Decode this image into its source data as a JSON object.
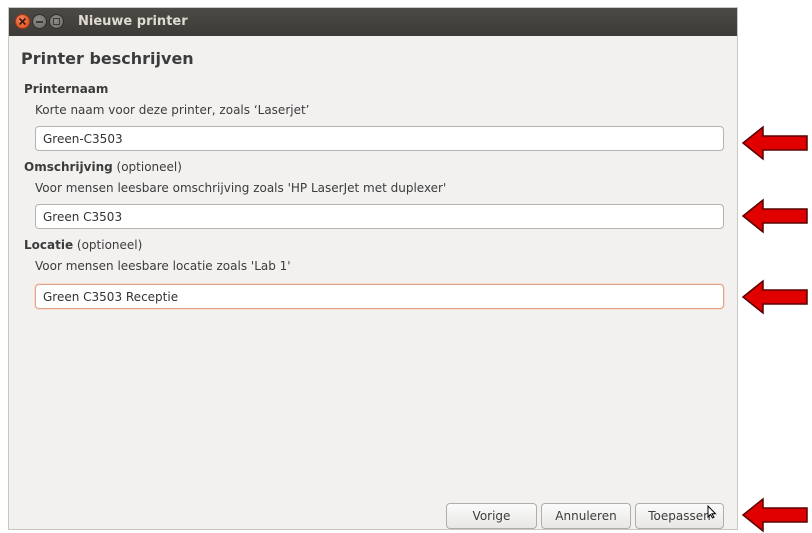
{
  "window": {
    "title": "Nieuwe printer"
  },
  "page": {
    "title": "Printer beschrijven"
  },
  "fields": {
    "printer_name": {
      "label": "Printernaam",
      "hint": "Korte naam voor deze printer, zoals ‘Laserjet’",
      "value": "Green-C3503"
    },
    "description": {
      "label": "Omschrijving",
      "optional": " (optioneel)",
      "hint": "Voor mensen leesbare omschrijving zoals 'HP LaserJet met duplexer'",
      "value": "Green C3503"
    },
    "location": {
      "label": "Locatie",
      "optional": " (optioneel)",
      "hint": "Voor mensen leesbare locatie zoals 'Lab 1'",
      "value": "Green C3503 Receptie"
    }
  },
  "buttons": {
    "back": "Vorige",
    "cancel": "Annuleren",
    "apply": "Toepassen"
  },
  "colors": {
    "annotation_arrow": "#e00000",
    "titlebar": "#3c3b37",
    "close_button": "#df4a16"
  },
  "icons": [
    "close-icon",
    "minimize-icon",
    "maximize-icon",
    "arrow-left-icon",
    "mouse-pointer-icon"
  ]
}
